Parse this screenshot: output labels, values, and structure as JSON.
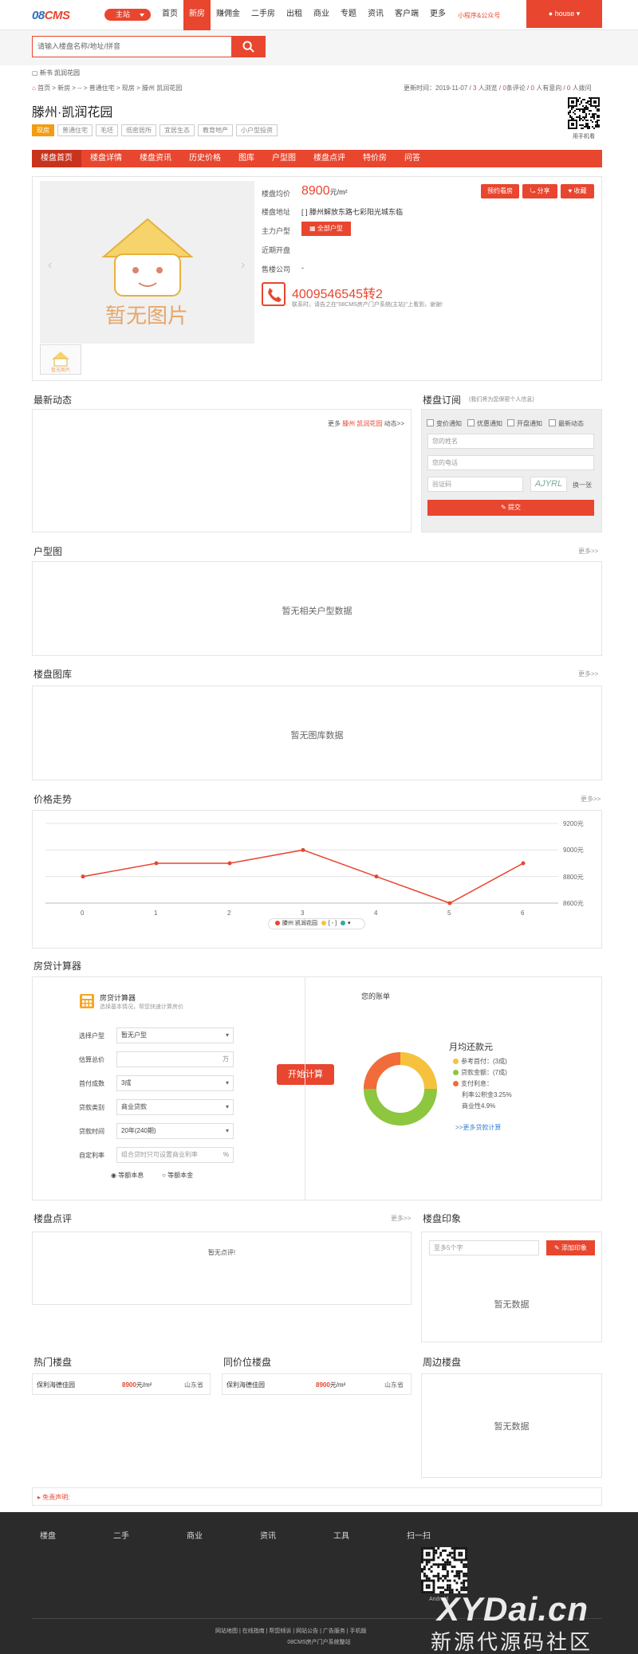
{
  "header": {
    "logo_main": "08",
    "logo_accent": "CMS",
    "station": "主站",
    "nav": [
      "首页",
      "新房",
      "赚佣金",
      "二手房",
      "出租",
      "商业",
      "专题",
      "资讯",
      "客户端",
      "更多"
    ],
    "active_nav": 1,
    "mini": "小程序&公众号",
    "user": "house"
  },
  "search": {
    "placeholder": "请输入楼盘名称/地址/拼音"
  },
  "banner_alt": "新书 凯润花园",
  "breadcrumb": "首页 > 新房 > -- > 普通住宅 > 现房 > 滕州 凯润花园",
  "meta": {
    "updated_label": "更新时间：",
    "updated": "2019-11-07",
    "views": "3",
    "views_label": "人浏览 /",
    "reviews": "0",
    "reviews_label": "条评论 /",
    "intent": "0",
    "intent_label": "人有意向 /",
    "calls": "0",
    "calls_label": "人拨问"
  },
  "qr_label": "用手机看",
  "title": "滕州·凯润花园",
  "tags": [
    "现房",
    "普通住宅",
    "毛坯",
    "低密居所",
    "宜居生态",
    "教育地产",
    "小户型投资"
  ],
  "subnav": [
    "楼盘首页",
    "楼盘详情",
    "楼盘资讯",
    "历史价格",
    "图库",
    "户型图",
    "楼盘点评",
    "特价房",
    "问答"
  ],
  "info": {
    "photo_text": "暂无图片",
    "thumb_text": "暂无图片",
    "price_label": "楼盘均价",
    "price": "8900",
    "price_unit": "元/m²",
    "address_label": "楼盘地址",
    "address": "[ ] 滕州解放东路七彩阳光城东临",
    "huxing_label": "主力户型",
    "huxing_btn": "全部户型",
    "open_label": "近期开盘",
    "open": "",
    "sale_label": "售楼公司",
    "sale": "-",
    "btn_appoint": "预约看房",
    "btn_share": "分享",
    "btn_fav": "收藏",
    "phone": "4009546545转2",
    "phone_note": "联系时，请告之在\"08CMS房产门户系统(主站)\"上看到，谢谢!"
  },
  "news": {
    "title": "最新动态",
    "more_prefix": "更多",
    "more_link": "滕州 凯润花园",
    "more_suffix": "动态>>"
  },
  "subscribe": {
    "title": "楼盘订阅",
    "subtitle": "(我们将为您保密个人信息)",
    "checks": [
      "变价通知",
      "优惠通知",
      "开盘通知",
      "最新动态"
    ],
    "name_ph": "您的姓名",
    "phone_ph": "您的电话",
    "code_ph": "验证码",
    "captcha": "AJYRL",
    "refresh": "换一张",
    "submit": "提交"
  },
  "huxing": {
    "title": "户型图",
    "more": "更多>>",
    "empty": "暂无相关户型数据"
  },
  "gallery": {
    "title": "楼盘图库",
    "more": "更多>>",
    "empty": "暂无图库数据"
  },
  "trend": {
    "title": "价格走势",
    "more": "更多>>",
    "legend": [
      "滕州 凯润花园",
      "[ - ]"
    ]
  },
  "chart_data": {
    "type": "line",
    "x": [
      0,
      1,
      2,
      3,
      4,
      5,
      6
    ],
    "series": [
      {
        "name": "滕州 凯润花园",
        "values": [
          8800,
          8900,
          8900,
          9000,
          8800,
          8600,
          8900
        ]
      }
    ],
    "ylim": [
      8600,
      9200
    ],
    "yticks": [
      "9200元",
      "9000元",
      "8800元",
      "8600元"
    ],
    "ytick_values": [
      9200,
      9000,
      8800,
      8600
    ],
    "title": "",
    "xlabel": "",
    "ylabel": "",
    "color": "#e8462f"
  },
  "calc": {
    "title": "房贷计算器",
    "widget_title": "房贷计算器",
    "widget_sub": "选择基本情况，帮您快速计算房价",
    "fields": [
      {
        "label": "选择户型",
        "value": "暂无户型"
      },
      {
        "label": "估算总价",
        "value": "",
        "unit": "万"
      },
      {
        "label": "首付成数",
        "value": "3成"
      },
      {
        "label": "贷款类别",
        "value": "商业贷款"
      },
      {
        "label": "贷款时间",
        "value": "20年(240期)"
      },
      {
        "label": "自定利率",
        "value": "组合贷时只可设置商业利率",
        "unit": "%"
      }
    ],
    "radio1": "等额本息",
    "radio2": "等额本金",
    "button": "开始计算",
    "bill_title": "您的账单",
    "monthly": "月均还款元",
    "legend": [
      "参考首付：(3成)",
      "贷款金额：(7成)",
      "支付利息：",
      "利率公积金3.25%",
      "商业性4.9%"
    ],
    "more": ">>更多贷款计算"
  },
  "review": {
    "title": "楼盘点评",
    "more": "更多>>",
    "empty": "暂无点评!"
  },
  "impress": {
    "title": "楼盘印象",
    "placeholder": "至多5个字",
    "add": "添加印象",
    "empty": "暂无数据"
  },
  "hot": {
    "title": "热门楼盘",
    "name": "保利海德佳园",
    "price": "8900",
    "unit": "元/m²",
    "region": "山东省"
  },
  "same": {
    "title": "同价位楼盘",
    "name": "保利海德佳园",
    "price": "8900",
    "unit": "元/m²",
    "region": "山东省"
  },
  "nearby": {
    "title": "周边楼盘",
    "empty": "暂无数据"
  },
  "disclaimer": "免责声明:",
  "footer": {
    "cols": [
      "楼盘",
      "二手",
      "商业",
      "资讯",
      "工具",
      "扫一扫"
    ],
    "qr_label": "Android",
    "links": "网站地图  |  在线指南  |  帮您倾诉  |  网站公告  |  广告服务  |  手机版",
    "copy": "08CMS房产门户系统整站",
    "wm1": "XYDai.cn",
    "wm2": "新源代源码社区"
  },
  "colors": {
    "accent": "#e8462f",
    "orange": "#f39c12",
    "green": "#8dc63f",
    "footer": "#2b2b2b"
  }
}
